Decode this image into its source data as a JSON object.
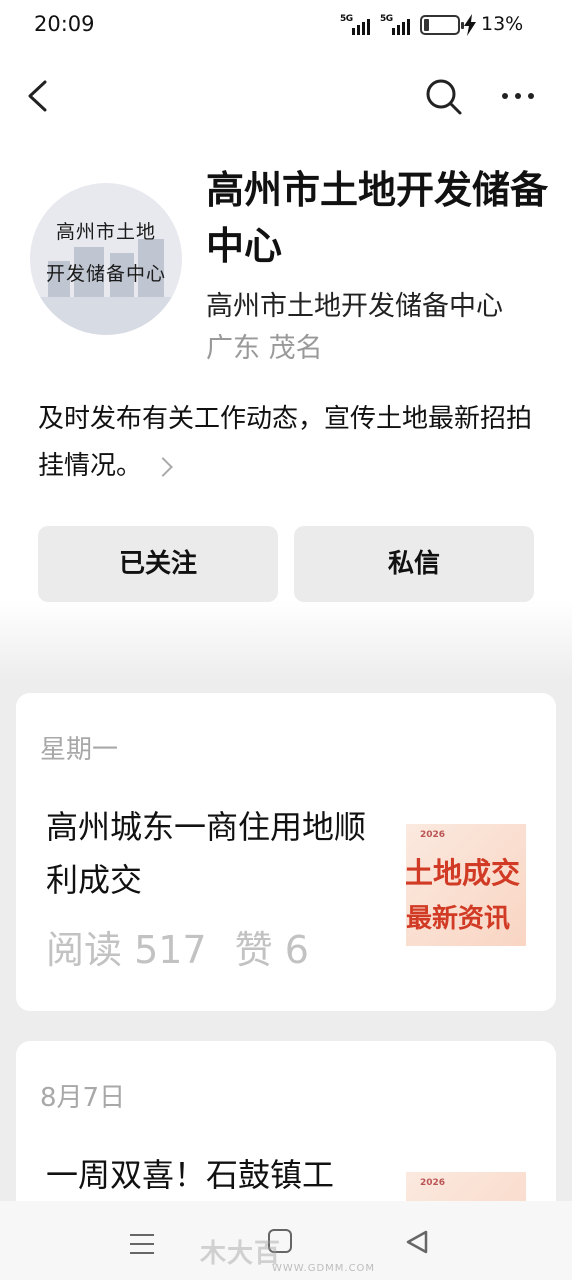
{
  "status_bar": {
    "time": "20:09",
    "sim1_network": "5G",
    "sim2_network": "5G",
    "battery_percent_text": "13%",
    "battery_level": 0.13,
    "charging": true
  },
  "nav": {
    "back_icon": "chevron-left-icon",
    "search_icon": "search-icon",
    "more_icon": "more-horizontal-icon"
  },
  "profile": {
    "avatar_text_line1": "高州市土地",
    "avatar_text_line2": "开发储备中心",
    "name": "高州市土地开发储备中心",
    "subname": "高州市土地开发储备中心",
    "location": "广东 茂名",
    "description": "及时发布有关工作动态，宣传土地最新招拍挂情况。"
  },
  "actions": {
    "follow_label": "已关注",
    "message_label": "私信"
  },
  "articles": [
    {
      "date": "星期一",
      "title": "高州城东一商住用地顺利成交",
      "reads": "阅读 517",
      "likes": "赞 6",
      "thumb_year": "2026",
      "thumb_line1": "土地成交",
      "thumb_line2": "最新资讯"
    },
    {
      "date": "8月7日",
      "title": "一周双喜！石鼓镇工",
      "thumb_year": "2026"
    }
  ],
  "system_nav": {
    "menu_icon": "menu-icon",
    "home_icon": "home-square-icon",
    "back_icon": "triangle-back-icon"
  },
  "watermark": {
    "text": "木大百",
    "url": "WWW.GDMM.COM"
  }
}
